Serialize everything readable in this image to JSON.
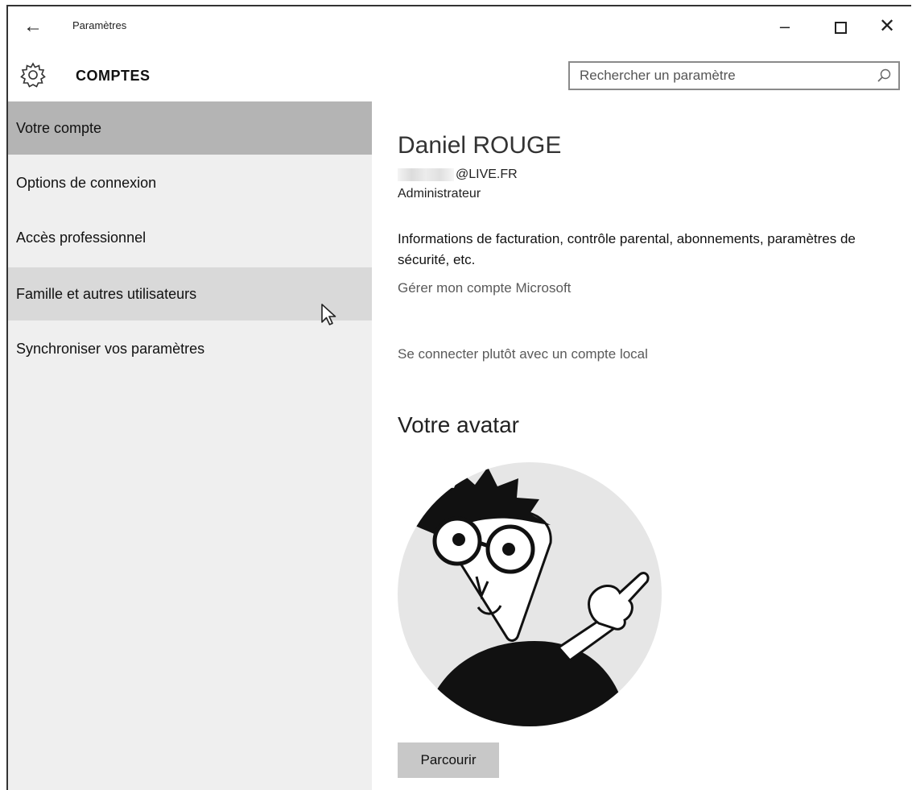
{
  "window": {
    "title": "Paramètres",
    "back_icon": "back-arrow-icon",
    "controls": {
      "minimize_icon": "minimize-icon",
      "maximize_icon": "maximize-icon",
      "close_icon": "close-icon"
    }
  },
  "header": {
    "icon": "gear-icon",
    "title": "COMPTES",
    "search_placeholder": "Rechercher un paramètre",
    "search_icon": "search-icon"
  },
  "sidebar": {
    "items": [
      {
        "label": "Votre compte",
        "state": "selected"
      },
      {
        "label": "Options de connexion",
        "state": "normal"
      },
      {
        "label": "Accès professionnel",
        "state": "normal"
      },
      {
        "label": "Famille et autres utilisateurs",
        "state": "hover"
      },
      {
        "label": "Synchroniser vos paramètres",
        "state": "normal"
      }
    ]
  },
  "account": {
    "name": "Daniel ROUGE",
    "email_suffix": "@LIVE.FR",
    "role": "Administrateur",
    "billing_info": "Informations de facturation, contrôle parental, abonnements, paramètres de sécurité, etc.",
    "manage_link": "Gérer mon compte Microsoft",
    "local_account_link": "Se connecter plutôt avec un compte local"
  },
  "avatar": {
    "heading": "Votre avatar",
    "browse_button": "Parcourir"
  },
  "colors": {
    "sidebar_bg": "#efefef",
    "selected_item": "#b4b4b4",
    "hover_item": "#d9d9d9",
    "button_bg": "#c8c8c8",
    "link": "#5a5a5a"
  }
}
